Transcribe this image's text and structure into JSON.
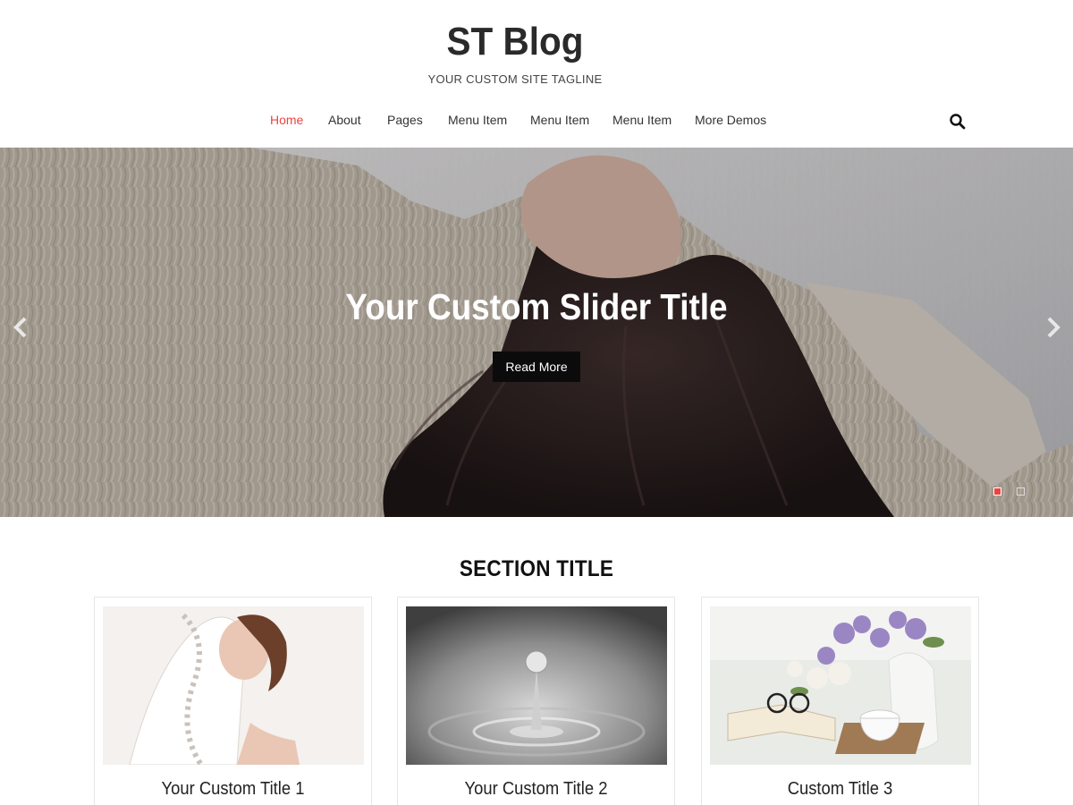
{
  "header": {
    "site_title": "ST Blog",
    "tagline": "YOUR CUSTOM SITE TAGLINE",
    "accent_color": "#e8463f"
  },
  "nav": {
    "items": [
      {
        "label": "Home",
        "active": true
      },
      {
        "label": "About",
        "active": false
      },
      {
        "label": "Pages",
        "active": false
      },
      {
        "label": "Menu Item",
        "active": false
      },
      {
        "label": "Menu Item",
        "active": false
      },
      {
        "label": "Menu Item",
        "active": false
      },
      {
        "label": "More Demos",
        "active": false
      }
    ],
    "search_icon": "search-icon"
  },
  "slider": {
    "title": "Your Custom Slider Title",
    "button_label": "Read More",
    "prev_icon": "chevron-left-icon",
    "next_icon": "chevron-right-icon",
    "slide_count": 2,
    "active_slide": 1
  },
  "section": {
    "title": "SECTION TITLE",
    "cards": [
      {
        "title": "Your Custom Title 1"
      },
      {
        "title": "Your Custom Title 2"
      },
      {
        "title": "Custom Title 3"
      }
    ]
  }
}
